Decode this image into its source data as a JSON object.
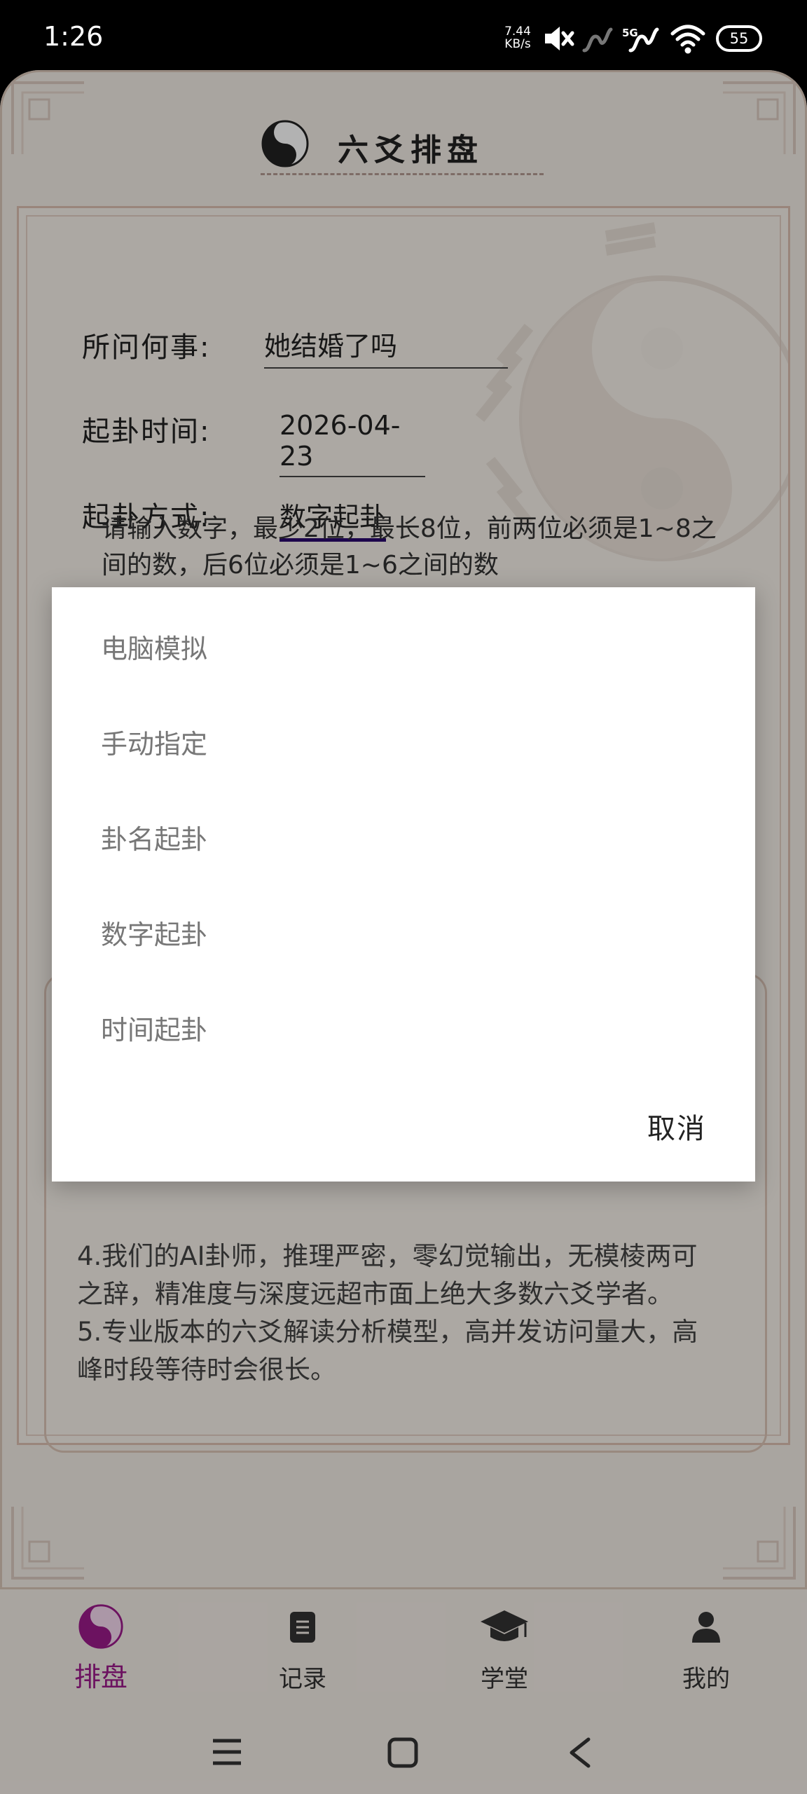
{
  "status_bar": {
    "time": "1:26",
    "net_speed_value": "7.44",
    "net_speed_unit": "KB/s",
    "network_label": "5G",
    "battery": "55",
    "icons": [
      "mute-icon",
      "signal-icon",
      "signal-5g-icon",
      "wifi-icon",
      "battery-icon"
    ]
  },
  "header": {
    "title": "六爻排盘",
    "logo_icon": "taiji-icon"
  },
  "form": {
    "question_label": "所问何事:",
    "question_value": "她结婚了吗",
    "time_label": "起卦时间:",
    "time_value": "2026-04-23",
    "method_label": "起卦方式:",
    "method_value": "数字起卦",
    "hint_line1": "请输入数字，最少2位，最长8位，前两位必须是1~8之",
    "hint_line2": "间的数，后6位必须是1~6之间的数"
  },
  "info_box": {
    "line1": "4.我们的AI卦师，推理严密，零幻觉输出，无模棱两可",
    "line2": "之辞，精准度与深度远超市面上绝大多数六爻学者。",
    "line3": "5.专业版本的六爻解读分析模型，高并发访问量大，高",
    "line4": "峰时段等待时会很长。"
  },
  "dialog": {
    "options": [
      "电脑模拟",
      "手动指定",
      "卦名起卦",
      "数字起卦",
      "时间起卦"
    ],
    "cancel": "取消"
  },
  "bottom_nav": {
    "items": [
      {
        "label": "排盘",
        "icon": "taiji-icon",
        "active": true
      },
      {
        "label": "记录",
        "icon": "document-icon",
        "active": false
      },
      {
        "label": "学堂",
        "icon": "graduation-cap-icon",
        "active": false
      },
      {
        "label": "我的",
        "icon": "user-icon",
        "active": false
      }
    ]
  },
  "colors": {
    "accent": "#9b1b8a",
    "underline_active": "#2a0a6e",
    "app_background": "#f3ede6",
    "frame_border": "#dcbfb0"
  }
}
